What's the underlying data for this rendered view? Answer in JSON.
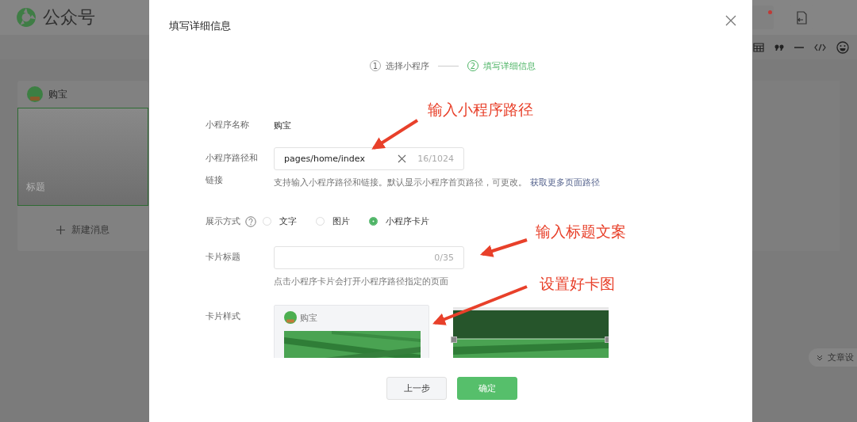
{
  "app": {
    "title": "公众号"
  },
  "editor": {
    "account": "购宝",
    "cover_placeholder": "标题",
    "new_message": "新建消息",
    "side_tab": "文章设"
  },
  "dialog": {
    "title": "填写详细信息",
    "steps": [
      {
        "number": "1",
        "label": "选择小程序",
        "selected": false
      },
      {
        "number": "2",
        "label": "填写详细信息",
        "selected": true
      }
    ],
    "name": {
      "label": "小程序名称",
      "value": "购宝"
    },
    "path": {
      "label": "小程序路径和链接",
      "value": "pages/home/index",
      "counter": "16/1024",
      "help": "支持输入小程序路径和链接。默认显示小程序首页路径，可更改。",
      "help_link": "获取更多页面路径"
    },
    "display": {
      "label": "展示方式",
      "options": [
        {
          "label": "文字",
          "selected": false
        },
        {
          "label": "图片",
          "selected": false
        },
        {
          "label": "小程序卡片",
          "selected": true
        }
      ]
    },
    "card_title": {
      "label": "卡片标题",
      "counter": "0/35",
      "help": "点击小程序卡片会打开小程序路径指定的页面"
    },
    "card_style": {
      "label": "卡片样式",
      "account": "购宝"
    },
    "buttons": [
      {
        "label": "上一步",
        "kind": "secondary"
      },
      {
        "label": "确定",
        "kind": "primary"
      }
    ]
  },
  "annotations": [
    {
      "text": "输入小程序路径"
    },
    {
      "text": "输入标题文案"
    },
    {
      "text": "设置好卡图"
    }
  ]
}
